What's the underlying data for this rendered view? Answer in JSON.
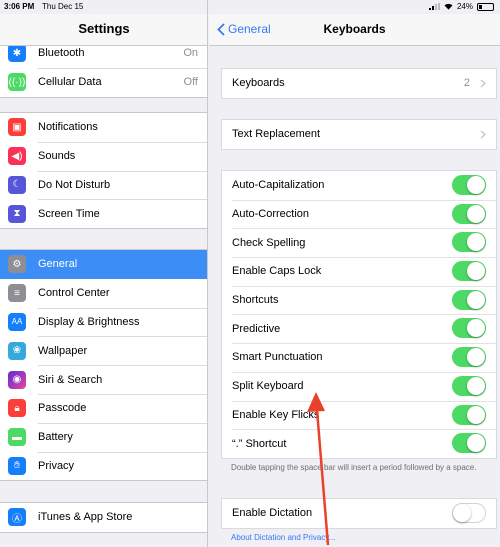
{
  "status": {
    "time": "3:06 PM",
    "date": "Thu Dec 15",
    "battery": "24%",
    "battery_level": 0.24
  },
  "left": {
    "title": "Settings",
    "group1": [
      {
        "label": "Bluetooth",
        "value": "On",
        "icon": "bluetooth-icon",
        "color": "#147efb"
      },
      {
        "label": "Cellular Data",
        "value": "Off",
        "icon": "cellular-icon",
        "color": "#4cd964"
      }
    ],
    "group2": [
      {
        "label": "Notifications",
        "icon": "notifications-icon",
        "color": "#fc3d39"
      },
      {
        "label": "Sounds",
        "icon": "sounds-icon",
        "color": "#fc3158"
      },
      {
        "label": "Do Not Disturb",
        "icon": "moon-icon",
        "color": "#5856d6"
      },
      {
        "label": "Screen Time",
        "icon": "hourglass-icon",
        "color": "#5856d6"
      }
    ],
    "group3": [
      {
        "label": "General",
        "icon": "gear-icon",
        "color": "#8e8e93",
        "selected": true
      },
      {
        "label": "Control Center",
        "icon": "control-center-icon",
        "color": "#8e8e93"
      },
      {
        "label": "Display & Brightness",
        "icon": "display-icon",
        "color": "#147efb"
      },
      {
        "label": "Wallpaper",
        "icon": "wallpaper-icon",
        "color": "#34aadc"
      },
      {
        "label": "Siri & Search",
        "icon": "siri-icon",
        "color": "#1c1c1e"
      },
      {
        "label": "Passcode",
        "icon": "lock-icon",
        "color": "#fc3d39"
      },
      {
        "label": "Battery",
        "icon": "battery-icon",
        "color": "#4cd964"
      },
      {
        "label": "Privacy",
        "icon": "hand-icon",
        "color": "#147efb"
      }
    ],
    "group4": [
      {
        "label": "iTunes & App Store",
        "icon": "app-store-icon",
        "color": "#147efb"
      }
    ]
  },
  "right": {
    "back_label": "General",
    "title": "Keyboards",
    "keyboards": {
      "label": "Keyboards",
      "count": "2"
    },
    "text_replacement": "Text Replacement",
    "toggles": [
      {
        "label": "Auto-Capitalization",
        "on": true
      },
      {
        "label": "Auto-Correction",
        "on": true
      },
      {
        "label": "Check Spelling",
        "on": true
      },
      {
        "label": "Enable Caps Lock",
        "on": true
      },
      {
        "label": "Shortcuts",
        "on": true
      },
      {
        "label": "Predictive",
        "on": true
      },
      {
        "label": "Smart Punctuation",
        "on": true
      },
      {
        "label": "Split Keyboard",
        "on": true
      },
      {
        "label": "Enable Key Flicks",
        "on": true
      },
      {
        "label": "“.” Shortcut",
        "on": true
      }
    ],
    "footnote": "Double tapping the space bar will insert a period followed by a space.",
    "dictation": {
      "label": "Enable Dictation",
      "on": false
    },
    "dictation_link": "About Dictation and Privacy..."
  },
  "colors": {
    "accent": "#3478f6",
    "toggle_on": "#4cd964",
    "selection": "#3d8df7",
    "arrow": "#e8412c"
  }
}
